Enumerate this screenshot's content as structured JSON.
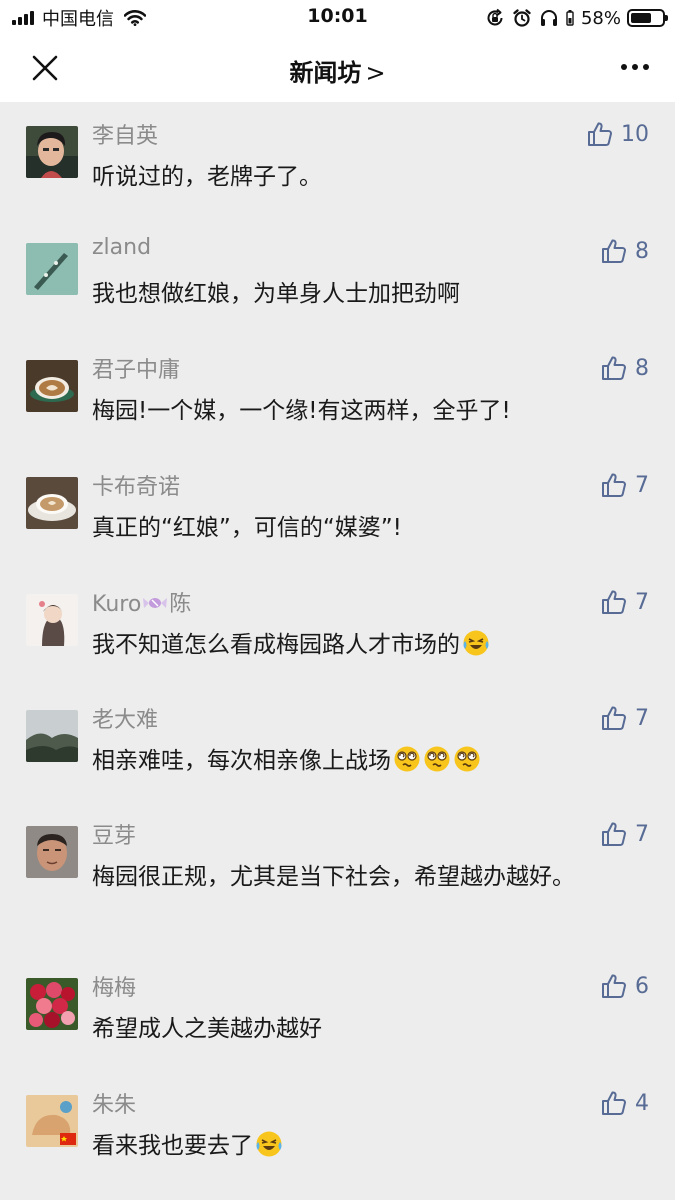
{
  "status_bar": {
    "carrier": "中国电信",
    "time": "10:01",
    "battery": "58%"
  },
  "nav": {
    "title": "新闻坊",
    "title_chevron": ">",
    "close_icon": "close-icon",
    "more_icon": "more-icon"
  },
  "colors": {
    "background": "#ededed",
    "like_blue": "#576b95",
    "name_gray": "#8b8b8b"
  },
  "comments": [
    {
      "name": "李自英",
      "text": "听说过的，老牌子了。",
      "likes": "10"
    },
    {
      "name": "zland",
      "text": "我也想做红娘，为单身人士加把劲啊",
      "likes": "8"
    },
    {
      "name": "君子中庸",
      "text": "梅园!一个媒，一个缘!有这两样，全乎了!",
      "likes": "8"
    },
    {
      "name": "卡布奇诺",
      "text": "真正的“红娘”，可信的“媒婆”!",
      "likes": "7"
    },
    {
      "name": "Kuro",
      "name_suffix": "陈",
      "text": "我不知道怎么看成梅园路人才市场的",
      "likes": "7"
    },
    {
      "name": "老大难",
      "text": "相亲难哇，每次相亲像上战场",
      "likes": "7"
    },
    {
      "name": "豆芽",
      "text": "梅园很正规，尤其是当下社会，希望越办越好。",
      "likes": "7"
    },
    {
      "name": "梅梅",
      "text": "希望成人之美越办越好",
      "likes": "6"
    },
    {
      "name": "朱朱",
      "text": "看来我也要去了",
      "likes": "4"
    }
  ]
}
